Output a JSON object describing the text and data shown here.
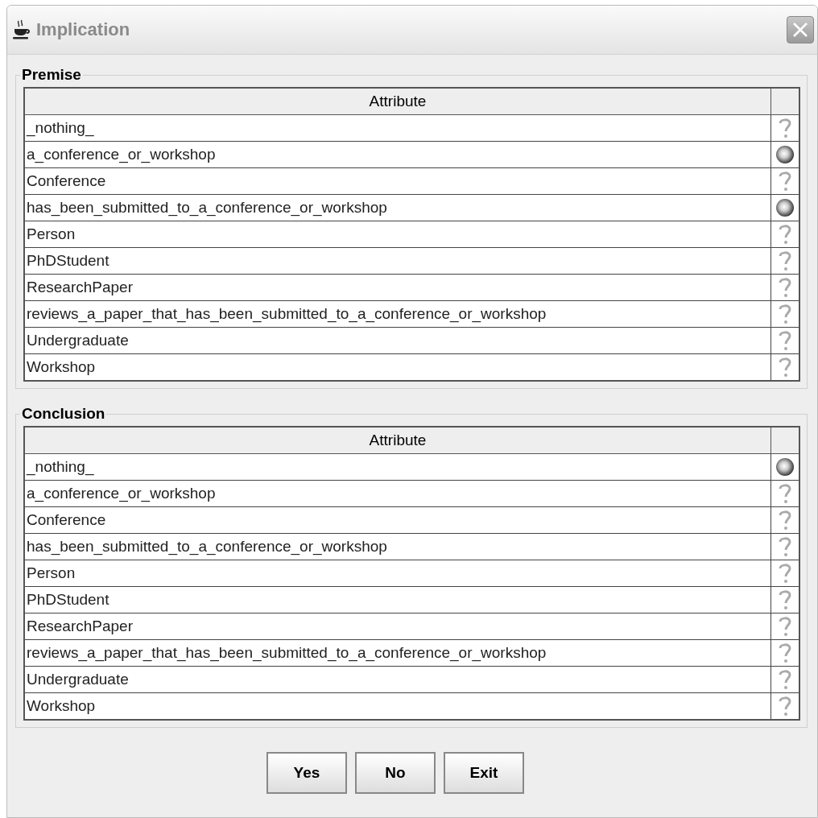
{
  "window": {
    "title": "Implication"
  },
  "panels": [
    {
      "title": "Premise",
      "columns": [
        "Attribute"
      ],
      "rows": [
        {
          "attribute": "_nothing_",
          "checked": false
        },
        {
          "attribute": "a_conference_or_workshop",
          "checked": true
        },
        {
          "attribute": "Conference",
          "checked": false
        },
        {
          "attribute": "has_been_submitted_to_a_conference_or_workshop",
          "checked": true
        },
        {
          "attribute": "Person",
          "checked": false
        },
        {
          "attribute": "PhDStudent",
          "checked": false
        },
        {
          "attribute": "ResearchPaper",
          "checked": false
        },
        {
          "attribute": "reviews_a_paper_that_has_been_submitted_to_a_conference_or_workshop",
          "checked": false
        },
        {
          "attribute": "Undergraduate",
          "checked": false
        },
        {
          "attribute": "Workshop",
          "checked": false
        }
      ]
    },
    {
      "title": "Conclusion",
      "columns": [
        "Attribute"
      ],
      "rows": [
        {
          "attribute": "_nothing_",
          "checked": true
        },
        {
          "attribute": "a_conference_or_workshop",
          "checked": false
        },
        {
          "attribute": "Conference",
          "checked": false
        },
        {
          "attribute": "has_been_submitted_to_a_conference_or_workshop",
          "checked": false
        },
        {
          "attribute": "Person",
          "checked": false
        },
        {
          "attribute": "PhDStudent",
          "checked": false
        },
        {
          "attribute": "ResearchPaper",
          "checked": false
        },
        {
          "attribute": "reviews_a_paper_that_has_been_submitted_to_a_conference_or_workshop",
          "checked": false
        },
        {
          "attribute": "Undergraduate",
          "checked": false
        },
        {
          "attribute": "Workshop",
          "checked": false
        }
      ]
    }
  ],
  "buttons": [
    "Yes",
    "No",
    "Exit"
  ]
}
